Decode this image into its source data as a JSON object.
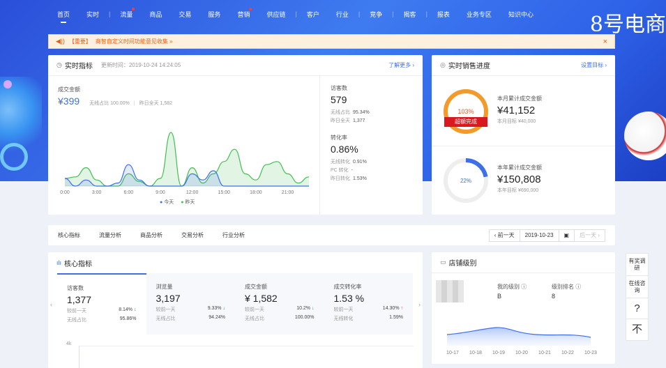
{
  "brand": "8号电商",
  "nav": [
    {
      "label": "首页",
      "active": true,
      "dot": false
    },
    {
      "label": "实时",
      "active": false,
      "dot": false
    },
    {
      "label": "流量",
      "active": false,
      "dot": true
    },
    {
      "label": "商品",
      "active": false,
      "dot": false
    },
    {
      "label": "交易",
      "active": false,
      "dot": false
    },
    {
      "label": "服务",
      "active": false,
      "dot": false
    },
    {
      "label": "营销",
      "active": false,
      "dot": true
    },
    {
      "label": "供应链",
      "active": false,
      "dot": false
    },
    {
      "label": "客户",
      "active": false,
      "dot": false
    },
    {
      "label": "行业",
      "active": false,
      "dot": false
    },
    {
      "label": "竞争",
      "active": false,
      "dot": false
    },
    {
      "label": "揭客",
      "active": false,
      "dot": false
    },
    {
      "label": "报表",
      "active": false,
      "dot": false
    },
    {
      "label": "业务专区",
      "active": false,
      "dot": false
    },
    {
      "label": "知识中心",
      "active": false,
      "dot": false
    }
  ],
  "notice": {
    "tag": "【重要】",
    "text": "商智自定义时间功能意见收集 »",
    "close": "×"
  },
  "realtime": {
    "title": "实时指标",
    "updated": "更新时间：2019-10-24 14:24:05",
    "more": "了解更多 ›",
    "amount_label": "成交金额",
    "amount": "¥399",
    "amount_meta1": "无线占比 100.00%",
    "amount_meta2": "昨日全天 1,582",
    "visitors_label": "访客数",
    "visitors": "579",
    "visitors_meta": [
      [
        "无线占比",
        "95.34%"
      ],
      [
        "昨日全天",
        "1,377"
      ]
    ],
    "conv_label": "转化率",
    "conv": "0.86%",
    "conv_meta": [
      [
        "无线转化",
        "0.91%"
      ],
      [
        "PC 转化",
        "-"
      ],
      [
        "昨日转化",
        "1.53%"
      ]
    ],
    "legend_today": "今天",
    "legend_yesterday": "昨天",
    "colors": {
      "today": "#3e6fe8",
      "yesterday": "#3fbf4f"
    }
  },
  "chart_data": {
    "type": "area",
    "x": [
      "0:00",
      "1:00",
      "2:00",
      "3:00",
      "4:00",
      "5:00",
      "6:00",
      "7:00",
      "8:00",
      "9:00",
      "10:00",
      "11:00",
      "12:00",
      "13:00",
      "14:00",
      "15:00",
      "16:00",
      "17:00",
      "18:00",
      "19:00",
      "20:00",
      "21:00",
      "22:00",
      "23:00"
    ],
    "x_ticks": [
      "0:00",
      "3:00",
      "6:00",
      "9:00",
      "12:00",
      "15:00",
      "18:00",
      "21:00"
    ],
    "series": [
      {
        "name": "今天",
        "values": [
          0,
          0,
          0,
          0,
          0,
          0,
          0,
          0,
          0,
          0,
          0,
          0,
          0,
          0,
          0,
          0,
          0,
          0,
          0,
          0,
          0,
          0,
          0,
          0
        ]
      },
      {
        "name": "昨天",
        "values": [
          5,
          6,
          12,
          4,
          0,
          0,
          8,
          3,
          0,
          5,
          35,
          0,
          12,
          2,
          8,
          16,
          24,
          8,
          4,
          14,
          16,
          8,
          2,
          6
        ]
      }
    ],
    "series_today_actual": [
      5,
      0,
      4,
      0,
      0,
      2,
      14,
      4,
      0,
      0,
      0,
      0,
      8,
      4,
      10,
      0,
      0,
      0,
      0,
      0,
      0,
      0,
      0,
      0
    ]
  },
  "sales": {
    "title": "实时销售进度",
    "link": "设置目标 ›",
    "month_label": "本月累计成交金额",
    "month_value": "¥41,152",
    "month_target": "本月目标 ¥40,000",
    "month_pct": "103%",
    "month_fill": 1.0,
    "month_badge": "超额完成",
    "year_label": "本年累计成交金额",
    "year_value": "¥150,808",
    "year_target": "本年目标 ¥690,000",
    "year_pct": "22%",
    "year_fill": 0.22
  },
  "tabs": [
    "核心指标",
    "流量分析",
    "商品分析",
    "交易分析",
    "行业分析"
  ],
  "date": {
    "prev": "‹ 前一天",
    "value": "2019-10-23",
    "next": "后一天 ›"
  },
  "core": {
    "title": "核心指标",
    "kpis": [
      {
        "label": "访客数",
        "value": "1,377",
        "r1k": "较前一天",
        "r1v": "8.14%",
        "r1a": "↓",
        "r2k": "无线占比",
        "r2v": "95.86%"
      },
      {
        "label": "浏览量",
        "value": "3,197",
        "r1k": "较前一天",
        "r1v": "9.33%",
        "r1a": "↓",
        "r2k": "无线占比",
        "r2v": "94.24%"
      },
      {
        "label": "成交金额",
        "value": "¥ 1,582",
        "r1k": "较前一天",
        "r1v": "10.2%",
        "r1a": "↓",
        "r2k": "无线占比",
        "r2v": "100.00%"
      },
      {
        "label": "成交转化率",
        "value": "1.53 %",
        "r1k": "较前一天",
        "r1v": "14.30%",
        "r1a": "↑",
        "r2k": "无线转化",
        "r2v": "1.59%"
      }
    ],
    "y_tick": "4k"
  },
  "level": {
    "title": "店铺级别",
    "my_level_label": "我的级别 ⓘ",
    "my_level": "B",
    "rank_label": "级别排名 ⓘ",
    "rank": "8",
    "x": [
      "10-17",
      "10-18",
      "10-19",
      "10-20",
      "10-21",
      "10-22",
      "10-23"
    ]
  },
  "side": [
    "有奖调研",
    "在线咨询",
    "?",
    "不"
  ]
}
